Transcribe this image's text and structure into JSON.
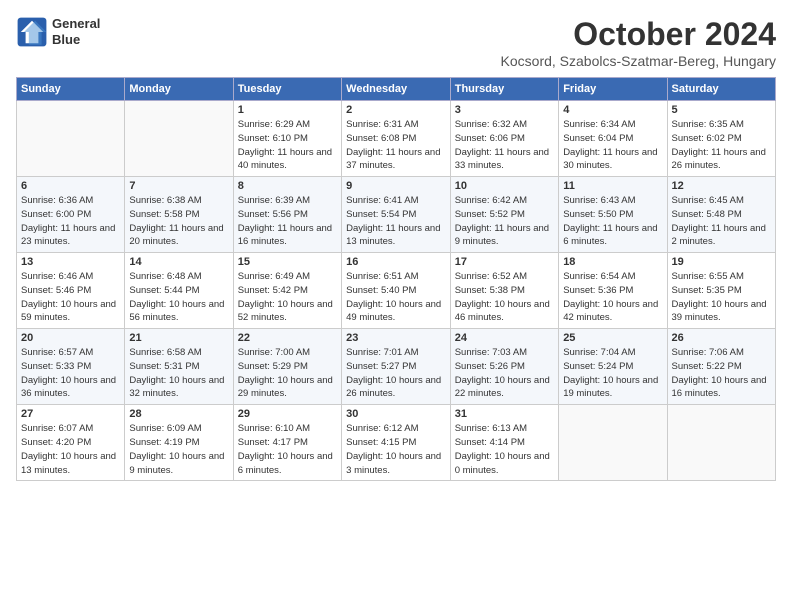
{
  "header": {
    "logo_line1": "General",
    "logo_line2": "Blue",
    "month": "October 2024",
    "location": "Kocsord, Szabolcs-Szatmar-Bereg, Hungary"
  },
  "weekdays": [
    "Sunday",
    "Monday",
    "Tuesday",
    "Wednesday",
    "Thursday",
    "Friday",
    "Saturday"
  ],
  "weeks": [
    [
      {
        "day": "",
        "info": ""
      },
      {
        "day": "",
        "info": ""
      },
      {
        "day": "1",
        "info": "Sunrise: 6:29 AM\nSunset: 6:10 PM\nDaylight: 11 hours and 40 minutes."
      },
      {
        "day": "2",
        "info": "Sunrise: 6:31 AM\nSunset: 6:08 PM\nDaylight: 11 hours and 37 minutes."
      },
      {
        "day": "3",
        "info": "Sunrise: 6:32 AM\nSunset: 6:06 PM\nDaylight: 11 hours and 33 minutes."
      },
      {
        "day": "4",
        "info": "Sunrise: 6:34 AM\nSunset: 6:04 PM\nDaylight: 11 hours and 30 minutes."
      },
      {
        "day": "5",
        "info": "Sunrise: 6:35 AM\nSunset: 6:02 PM\nDaylight: 11 hours and 26 minutes."
      }
    ],
    [
      {
        "day": "6",
        "info": "Sunrise: 6:36 AM\nSunset: 6:00 PM\nDaylight: 11 hours and 23 minutes."
      },
      {
        "day": "7",
        "info": "Sunrise: 6:38 AM\nSunset: 5:58 PM\nDaylight: 11 hours and 20 minutes."
      },
      {
        "day": "8",
        "info": "Sunrise: 6:39 AM\nSunset: 5:56 PM\nDaylight: 11 hours and 16 minutes."
      },
      {
        "day": "9",
        "info": "Sunrise: 6:41 AM\nSunset: 5:54 PM\nDaylight: 11 hours and 13 minutes."
      },
      {
        "day": "10",
        "info": "Sunrise: 6:42 AM\nSunset: 5:52 PM\nDaylight: 11 hours and 9 minutes."
      },
      {
        "day": "11",
        "info": "Sunrise: 6:43 AM\nSunset: 5:50 PM\nDaylight: 11 hours and 6 minutes."
      },
      {
        "day": "12",
        "info": "Sunrise: 6:45 AM\nSunset: 5:48 PM\nDaylight: 11 hours and 2 minutes."
      }
    ],
    [
      {
        "day": "13",
        "info": "Sunrise: 6:46 AM\nSunset: 5:46 PM\nDaylight: 10 hours and 59 minutes."
      },
      {
        "day": "14",
        "info": "Sunrise: 6:48 AM\nSunset: 5:44 PM\nDaylight: 10 hours and 56 minutes."
      },
      {
        "day": "15",
        "info": "Sunrise: 6:49 AM\nSunset: 5:42 PM\nDaylight: 10 hours and 52 minutes."
      },
      {
        "day": "16",
        "info": "Sunrise: 6:51 AM\nSunset: 5:40 PM\nDaylight: 10 hours and 49 minutes."
      },
      {
        "day": "17",
        "info": "Sunrise: 6:52 AM\nSunset: 5:38 PM\nDaylight: 10 hours and 46 minutes."
      },
      {
        "day": "18",
        "info": "Sunrise: 6:54 AM\nSunset: 5:36 PM\nDaylight: 10 hours and 42 minutes."
      },
      {
        "day": "19",
        "info": "Sunrise: 6:55 AM\nSunset: 5:35 PM\nDaylight: 10 hours and 39 minutes."
      }
    ],
    [
      {
        "day": "20",
        "info": "Sunrise: 6:57 AM\nSunset: 5:33 PM\nDaylight: 10 hours and 36 minutes."
      },
      {
        "day": "21",
        "info": "Sunrise: 6:58 AM\nSunset: 5:31 PM\nDaylight: 10 hours and 32 minutes."
      },
      {
        "day": "22",
        "info": "Sunrise: 7:00 AM\nSunset: 5:29 PM\nDaylight: 10 hours and 29 minutes."
      },
      {
        "day": "23",
        "info": "Sunrise: 7:01 AM\nSunset: 5:27 PM\nDaylight: 10 hours and 26 minutes."
      },
      {
        "day": "24",
        "info": "Sunrise: 7:03 AM\nSunset: 5:26 PM\nDaylight: 10 hours and 22 minutes."
      },
      {
        "day": "25",
        "info": "Sunrise: 7:04 AM\nSunset: 5:24 PM\nDaylight: 10 hours and 19 minutes."
      },
      {
        "day": "26",
        "info": "Sunrise: 7:06 AM\nSunset: 5:22 PM\nDaylight: 10 hours and 16 minutes."
      }
    ],
    [
      {
        "day": "27",
        "info": "Sunrise: 6:07 AM\nSunset: 4:20 PM\nDaylight: 10 hours and 13 minutes."
      },
      {
        "day": "28",
        "info": "Sunrise: 6:09 AM\nSunset: 4:19 PM\nDaylight: 10 hours and 9 minutes."
      },
      {
        "day": "29",
        "info": "Sunrise: 6:10 AM\nSunset: 4:17 PM\nDaylight: 10 hours and 6 minutes."
      },
      {
        "day": "30",
        "info": "Sunrise: 6:12 AM\nSunset: 4:15 PM\nDaylight: 10 hours and 3 minutes."
      },
      {
        "day": "31",
        "info": "Sunrise: 6:13 AM\nSunset: 4:14 PM\nDaylight: 10 hours and 0 minutes."
      },
      {
        "day": "",
        "info": ""
      },
      {
        "day": "",
        "info": ""
      }
    ]
  ]
}
